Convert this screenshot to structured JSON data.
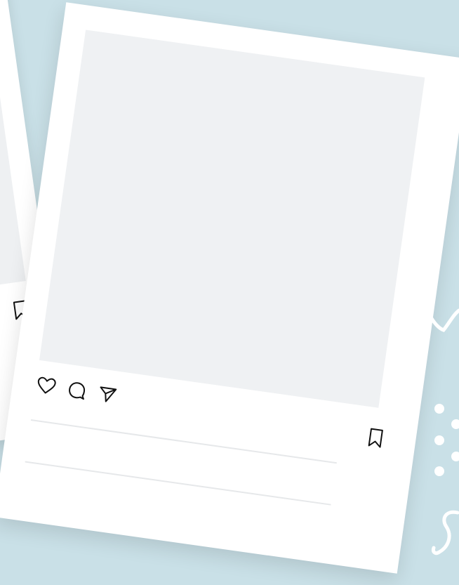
{
  "background_color": "#c9e0e7",
  "card_color": "#ffffff",
  "photo_placeholder_color": "#eff1f3",
  "caption_line_color": "#e6e8ea",
  "post": {
    "actions": [
      "heart-icon",
      "comment-icon",
      "send-icon"
    ],
    "save_icon": "bookmark-icon",
    "caption_lines": 2
  },
  "back_post": {
    "save_icon": "bookmark-icon"
  }
}
